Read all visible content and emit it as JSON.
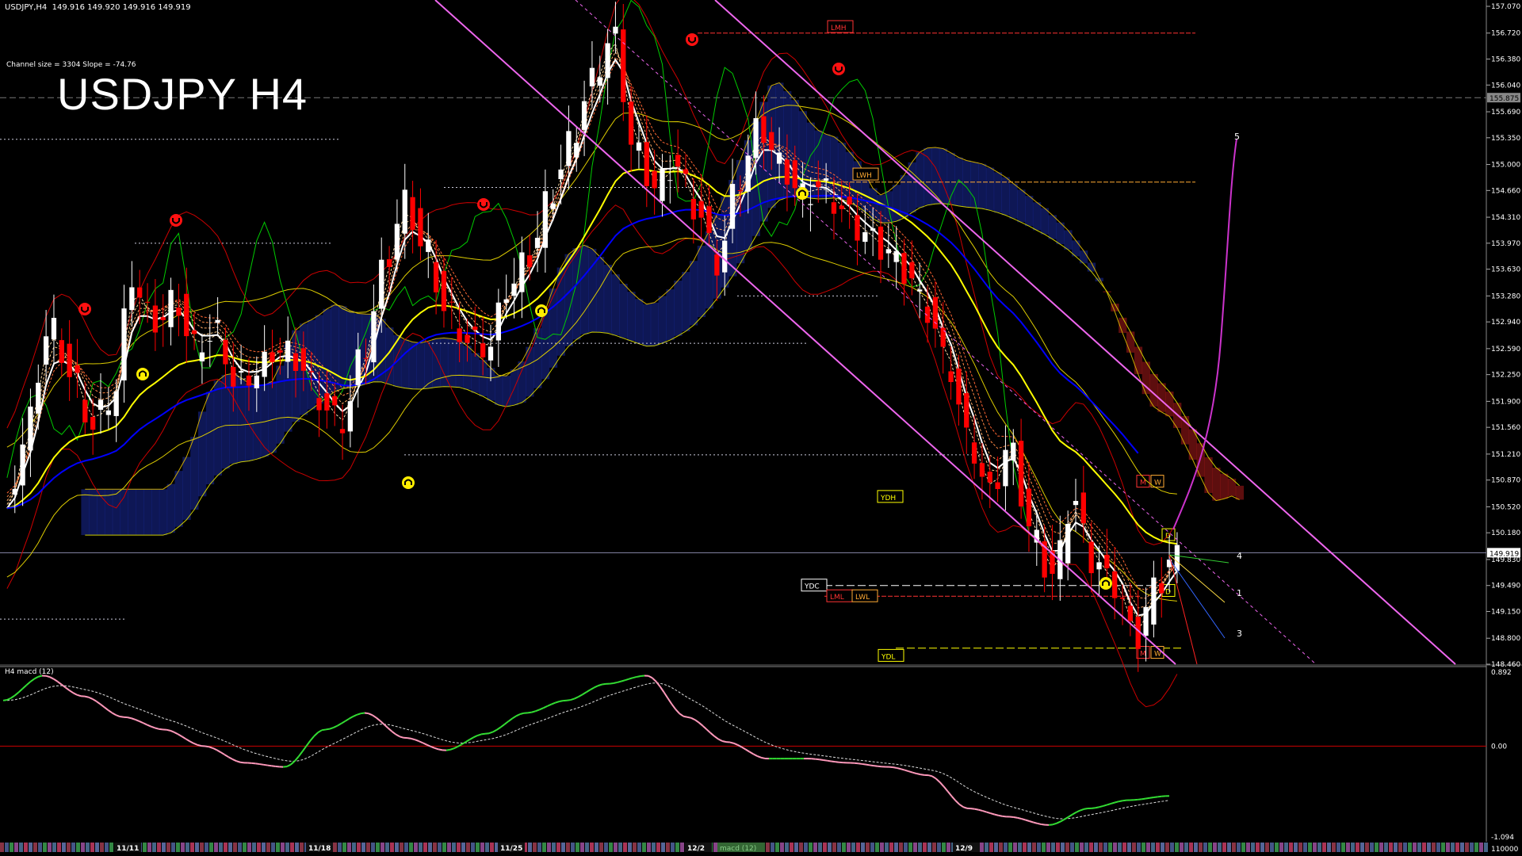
{
  "header": {
    "symbol_info": "USDJPY,H4  149.916 149.920 149.916 149.919",
    "channel_info": "Channel size = 3304 Slope = -74.76",
    "title": "USDJPY H4"
  },
  "macd_panel": {
    "label": "H4  macd (12)",
    "axis_ticks": [
      "0.892",
      "0.00",
      "-1.094"
    ],
    "zero_value": 0
  },
  "price_axis": {
    "ticks": [
      "157.070",
      "156.720",
      "156.380",
      "156.040",
      "155.690",
      "155.350",
      "155.000",
      "154.660",
      "154.310",
      "153.970",
      "153.630",
      "153.280",
      "152.940",
      "152.590",
      "152.250",
      "151.900",
      "151.560",
      "151.210",
      "150.870",
      "150.520",
      "150.180",
      "149.830",
      "149.490",
      "149.150",
      "148.800",
      "148.460"
    ],
    "last_price": "149.919",
    "marker_price": "155.875",
    "bottom_volume": "110000"
  },
  "time_axis": {
    "labels": [
      "11/11",
      "11/18",
      "11/25",
      "12/2",
      "12/9"
    ],
    "overlay_tag": "macd (12)"
  },
  "level_tags": {
    "lmh": "LMH",
    "lwh": "LWH",
    "ydh": "YDH",
    "ydc": "YDC",
    "lml": "LML",
    "lwl": "LWL",
    "ydl": "YDL",
    "m": "M",
    "w": "W",
    "d": "D"
  },
  "wave_labels": [
    "5",
    "4",
    "1",
    "3"
  ],
  "colors": {
    "background": "#000000",
    "bull_candle": "#ffffff",
    "bear_candle": "#ff0000",
    "ema_yellow": "#ffff00",
    "ema_blue": "#0000ff",
    "green_line": "#00cc00",
    "channel": "#ee66ee",
    "cloud_blue": "#1a2a9a",
    "cloud_red": "#aa1a1a",
    "macd_up": "#33dd33",
    "macd_down": "#ff99bb"
  },
  "chart_data": {
    "type": "candlestick",
    "symbol": "USDJPY",
    "timeframe": "H4",
    "ylim": [
      148.46,
      157.07
    ],
    "x_labels": [
      "11/11",
      "11/18",
      "11/25",
      "12/2",
      "12/9"
    ],
    "last": 149.919,
    "ohlc_header": {
      "open": 149.916,
      "high": 149.92,
      "low": 149.916,
      "close": 149.919
    },
    "key_levels": [
      {
        "name": "LMH",
        "value": 156.72
      },
      {
        "name": "LWH",
        "value": 154.77
      },
      {
        "name": "YDC",
        "value": 149.49
      },
      {
        "name": "LML",
        "value": 149.35
      },
      {
        "name": "LWL",
        "value": 149.35
      },
      {
        "name": "YDL",
        "value": 148.67
      }
    ],
    "series": [
      {
        "name": "price",
        "values": [
          150.5,
          151.6,
          152.9,
          152.3,
          151.6,
          151.9,
          153.5,
          152.9,
          153.2,
          152.6,
          152.8,
          152.1,
          152.3,
          152.6,
          152.4,
          151.9,
          151.6,
          152.5,
          153.6,
          154.5,
          153.9,
          153.1,
          152.7,
          152.6,
          153.4,
          153.8,
          154.6,
          155.3,
          156.1,
          156.7,
          155.2,
          154.7,
          155.0,
          154.4,
          153.7,
          154.8,
          155.5,
          155.0,
          154.6,
          154.7,
          154.4,
          154.1,
          153.9,
          153.6,
          153.1,
          152.4,
          151.4,
          150.7,
          151.3,
          150.2,
          149.6,
          150.6,
          149.8,
          149.5,
          148.8,
          149.5,
          149.9
        ]
      }
    ],
    "macd": {
      "values": [
        0.55,
        0.85,
        0.6,
        0.35,
        0.2,
        0.0,
        -0.2,
        -0.25,
        0.2,
        0.4,
        0.1,
        -0.05,
        0.15,
        0.4,
        0.55,
        0.75,
        0.85,
        0.35,
        0.05,
        -0.15,
        -0.15,
        -0.2,
        -0.25,
        -0.35,
        -0.75,
        -0.85,
        -0.95,
        -0.75,
        -0.65,
        -0.6
      ],
      "ylim": [
        -1.094,
        0.892
      ]
    }
  }
}
